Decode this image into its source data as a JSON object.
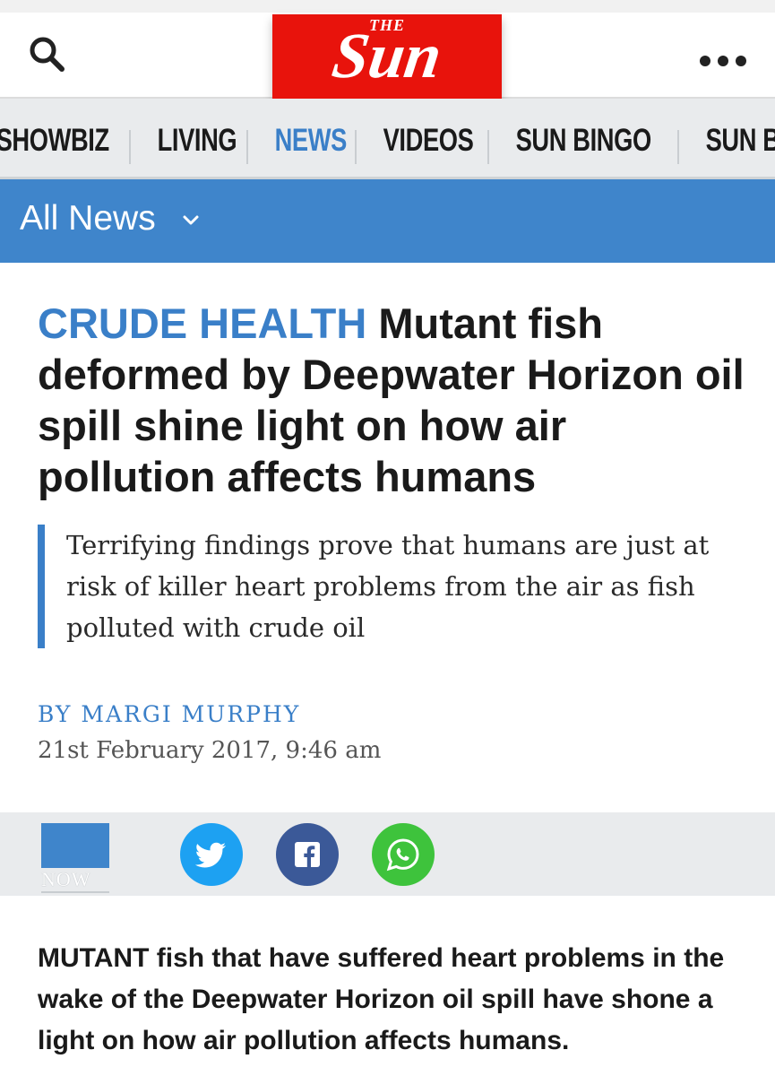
{
  "header": {
    "logo_small": "THE",
    "logo_main": "Sun",
    "search_icon": "search-icon",
    "more_icon": "more-dots-icon"
  },
  "nav": {
    "items": [
      "SHOWBIZ",
      "LIVING",
      "NEWS",
      "VIDEOS",
      "SUN BINGO",
      "SUN BETS"
    ],
    "active": "NEWS"
  },
  "section": {
    "label": "All News",
    "icon": "chevron-down-icon"
  },
  "article": {
    "kicker": "CRUDE HEALTH",
    "headline": "Mutant fish deformed by Deepwater Horizon oil spill shine light on how air pollution affects humans",
    "standfirst": "Terrifying findings prove that humans are just at risk of killer heart problems from the air as fish polluted with crude oil",
    "byline": "BY MARGI MURPHY",
    "date": "21st February 2017, 9:46 am",
    "lead": "MUTANT fish that have suffered heart problems in the wake of the Deepwater Horizon oil spill have shone a light on how air pollution affects humans."
  },
  "share": {
    "now_label": "NOW",
    "buttons": [
      {
        "name": "twitter",
        "icon": "twitter-icon",
        "color": "#1da1f2"
      },
      {
        "name": "facebook",
        "icon": "facebook-icon",
        "color": "#3b5998"
      },
      {
        "name": "whatsapp",
        "icon": "whatsapp-icon",
        "color": "#3ec33c"
      }
    ]
  },
  "colors": {
    "brand_red": "#e8130c",
    "accent_blue": "#3a7fc8",
    "section_blue": "#3f85cb",
    "nav_bg": "#e9ebed"
  }
}
